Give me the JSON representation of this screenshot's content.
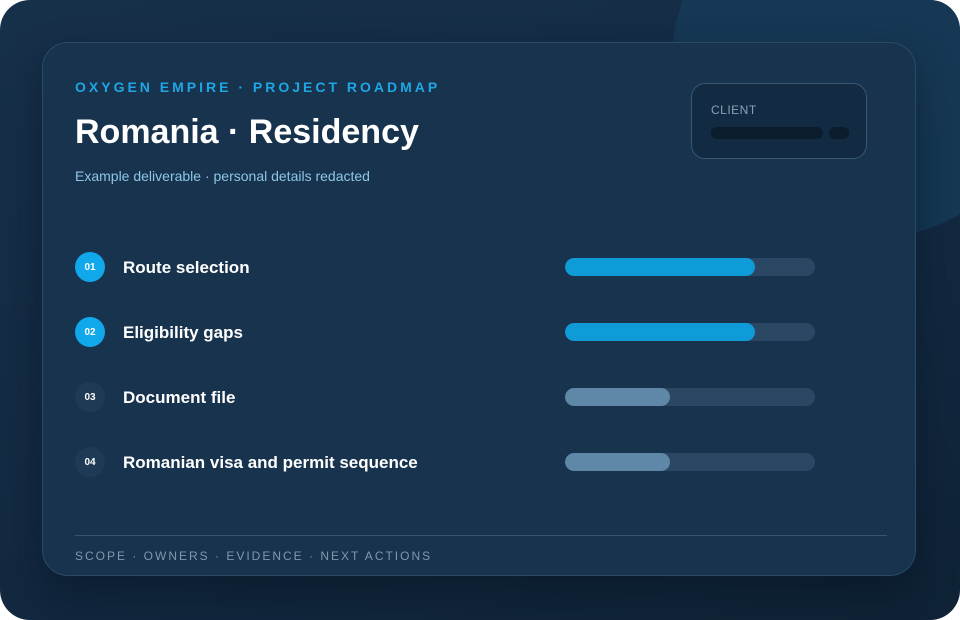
{
  "header": {
    "eyebrow": "OXYGEN EMPIRE · PROJECT ROADMAP",
    "title": "Romania · Residency",
    "subtitle": "Example deliverable · personal details redacted"
  },
  "client": {
    "label": "CLIENT"
  },
  "steps": [
    {
      "number": "01",
      "label": "Route selection",
      "progress": 0.76,
      "active": true
    },
    {
      "number": "02",
      "label": "Eligibility gaps",
      "progress": 0.76,
      "active": true
    },
    {
      "number": "03",
      "label": "Document file",
      "progress": 0.42,
      "active": false
    },
    {
      "number": "04",
      "label": "Romanian visa and permit sequence",
      "progress": 0.42,
      "active": false
    }
  ],
  "footer": {
    "text": "SCOPE · OWNERS · EVIDENCE · NEXT ACTIONS"
  },
  "colors": {
    "accent": "#10a8ea",
    "progress_active": "#0f9bd8",
    "progress_muted": "#5f88a8"
  }
}
